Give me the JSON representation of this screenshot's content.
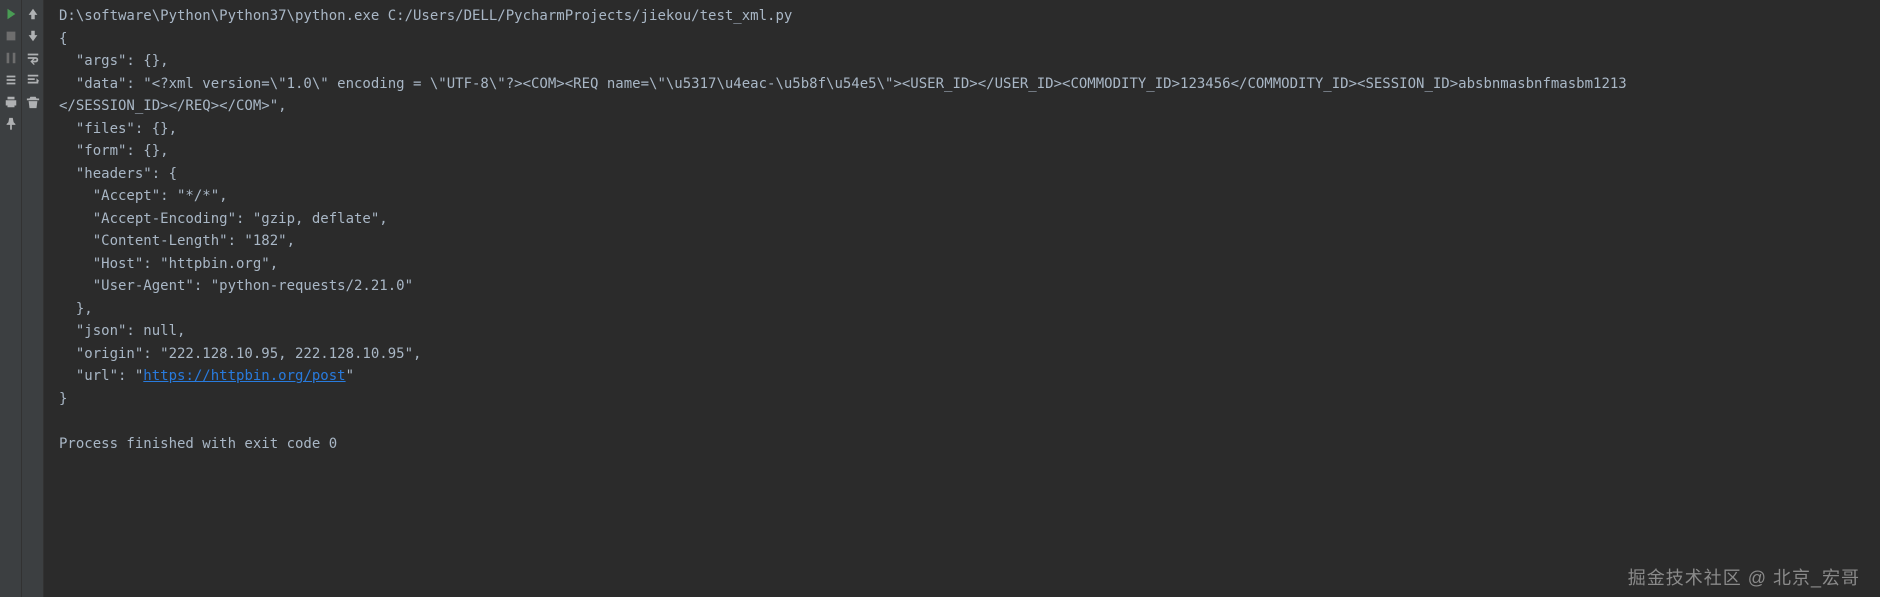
{
  "console": {
    "command": "D:\\software\\Python\\Python37\\python.exe C:/Users/DELL/PycharmProjects/jiekou/test_xml.py",
    "lines": [
      "{",
      "  \"args\": {},",
      "  \"data\": \"<?xml version=\\\"1.0\\\" encoding = \\\"UTF-8\\\"?><COM><REQ name=\\\"\\u5317\\u4eac-\\u5b8f\\u54e5\\\"><USER_ID></USER_ID><COMMODITY_ID>123456</COMMODITY_ID><SESSION_ID>absbnmasbnfmasbm1213",
      "</SESSION_ID></REQ></COM>\",",
      "  \"files\": {},",
      "  \"form\": {},",
      "  \"headers\": {",
      "    \"Accept\": \"*/*\",",
      "    \"Accept-Encoding\": \"gzip, deflate\",",
      "    \"Content-Length\": \"182\",",
      "    \"Host\": \"httpbin.org\",",
      "    \"User-Agent\": \"python-requests/2.21.0\"",
      "  },",
      "  \"json\": null,",
      "  \"origin\": \"222.128.10.95, 222.128.10.95\","
    ],
    "url_prefix": "  \"url\": \"",
    "url": "https://httpbin.org/post",
    "url_suffix": "\"",
    "close_brace": "}",
    "exit": "Process finished with exit code 0"
  },
  "watermark": "掘金技术社区 @ 北京_宏哥"
}
